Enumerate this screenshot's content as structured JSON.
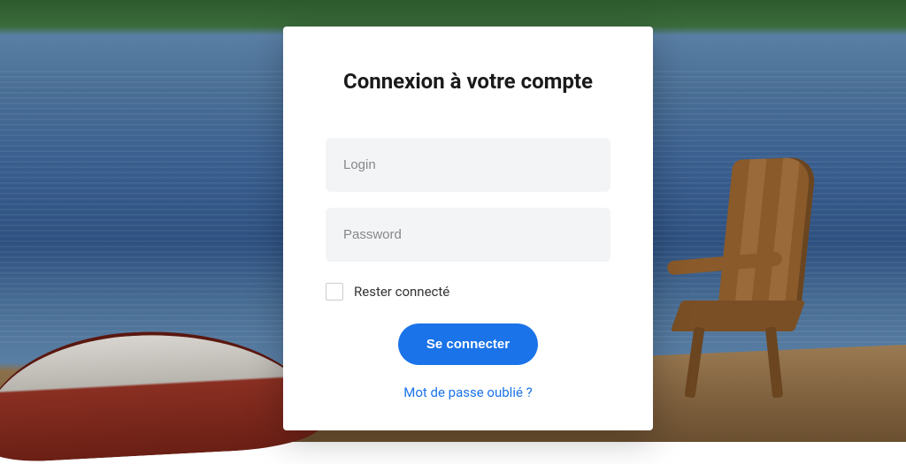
{
  "login": {
    "title": "Connexion à votre compte",
    "login_placeholder": "Login",
    "password_placeholder": "Password",
    "remember_label": "Rester connecté",
    "submit_label": "Se connecter",
    "forgot_label": "Mot de passe oublié ?"
  },
  "colors": {
    "primary": "#1a73e8"
  }
}
